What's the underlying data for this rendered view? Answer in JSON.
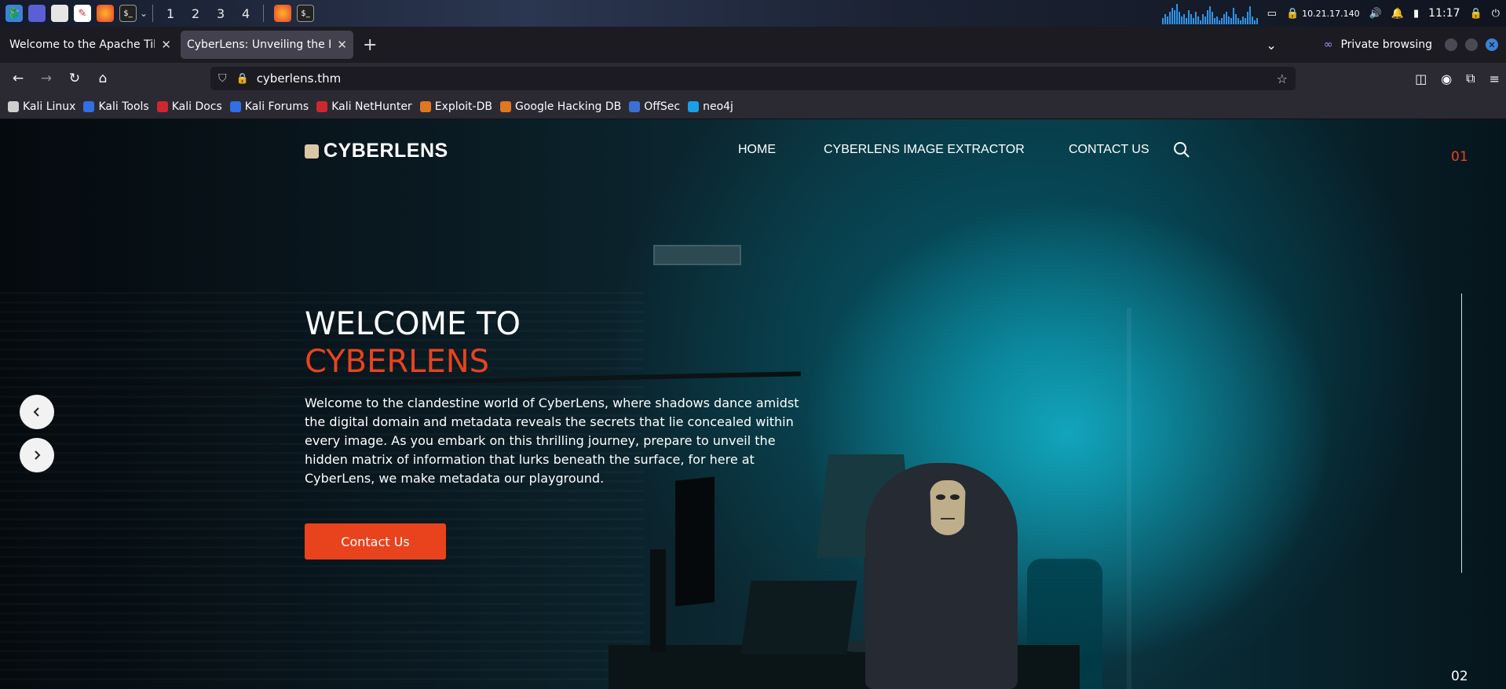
{
  "os_panel": {
    "workspaces": [
      "1",
      "2",
      "3",
      "4"
    ],
    "ip": "10.21.17.140",
    "time": "11:17",
    "graph_levels": [
      0.3,
      0.5,
      0.4,
      0.6,
      0.8,
      0.7,
      1.0,
      0.6,
      0.4,
      0.5,
      0.3,
      0.7,
      0.5,
      0.3,
      0.6,
      0.4,
      0.2,
      0.5,
      0.4,
      0.7,
      0.9,
      0.6,
      0.3,
      0.4,
      0.2,
      0.3,
      0.5,
      0.6,
      0.4,
      0.3,
      0.8,
      0.5,
      0.3,
      0.2,
      0.4,
      0.3,
      0.6,
      0.9,
      0.4,
      0.2,
      0.3
    ]
  },
  "browser": {
    "tabs": [
      {
        "title": "Welcome to the Apache Tika",
        "active": false
      },
      {
        "title": "CyberLens: Unveiling the Hid",
        "active": true
      }
    ],
    "new_tab_glyph": "+",
    "tab_list_glyph": "⌄",
    "private_label": "Private browsing",
    "url": "cyberlens.thm",
    "bookmarks": [
      {
        "label": "Kali Linux",
        "color": "#cfcfcf"
      },
      {
        "label": "Kali Tools",
        "color": "#2f6fe8"
      },
      {
        "label": "Kali Docs",
        "color": "#d0262d"
      },
      {
        "label": "Kali Forums",
        "color": "#2f6fe8"
      },
      {
        "label": "Kali NetHunter",
        "color": "#d0262d"
      },
      {
        "label": "Exploit-DB",
        "color": "#e2771e"
      },
      {
        "label": "Google Hacking DB",
        "color": "#e2771e"
      },
      {
        "label": "OffSec",
        "color": "#3a6fd6"
      },
      {
        "label": "neo4j",
        "color": "#1aa0e6"
      }
    ]
  },
  "site": {
    "logo": "CYBERLENS",
    "menu": {
      "home": "HOME",
      "extractor": "CYBERLENS IMAGE EXTRACTOR",
      "contact": "CONTACT US"
    },
    "slider": {
      "current": "01",
      "next": "02"
    },
    "hero": {
      "line1": "WELCOME TO",
      "line2": "CYBERLENS",
      "body": "Welcome to the clandestine world of CyberLens, where shadows dance amidst the digital domain and metadata reveals the secrets that lie concealed within every image. As you embark on this thrilling journey, prepare to unveil the hidden matrix of information that lurks beneath the surface, for here at CyberLens, we make metadata our playground.",
      "button": "Contact Us"
    },
    "accent_color": "#e8431d"
  }
}
